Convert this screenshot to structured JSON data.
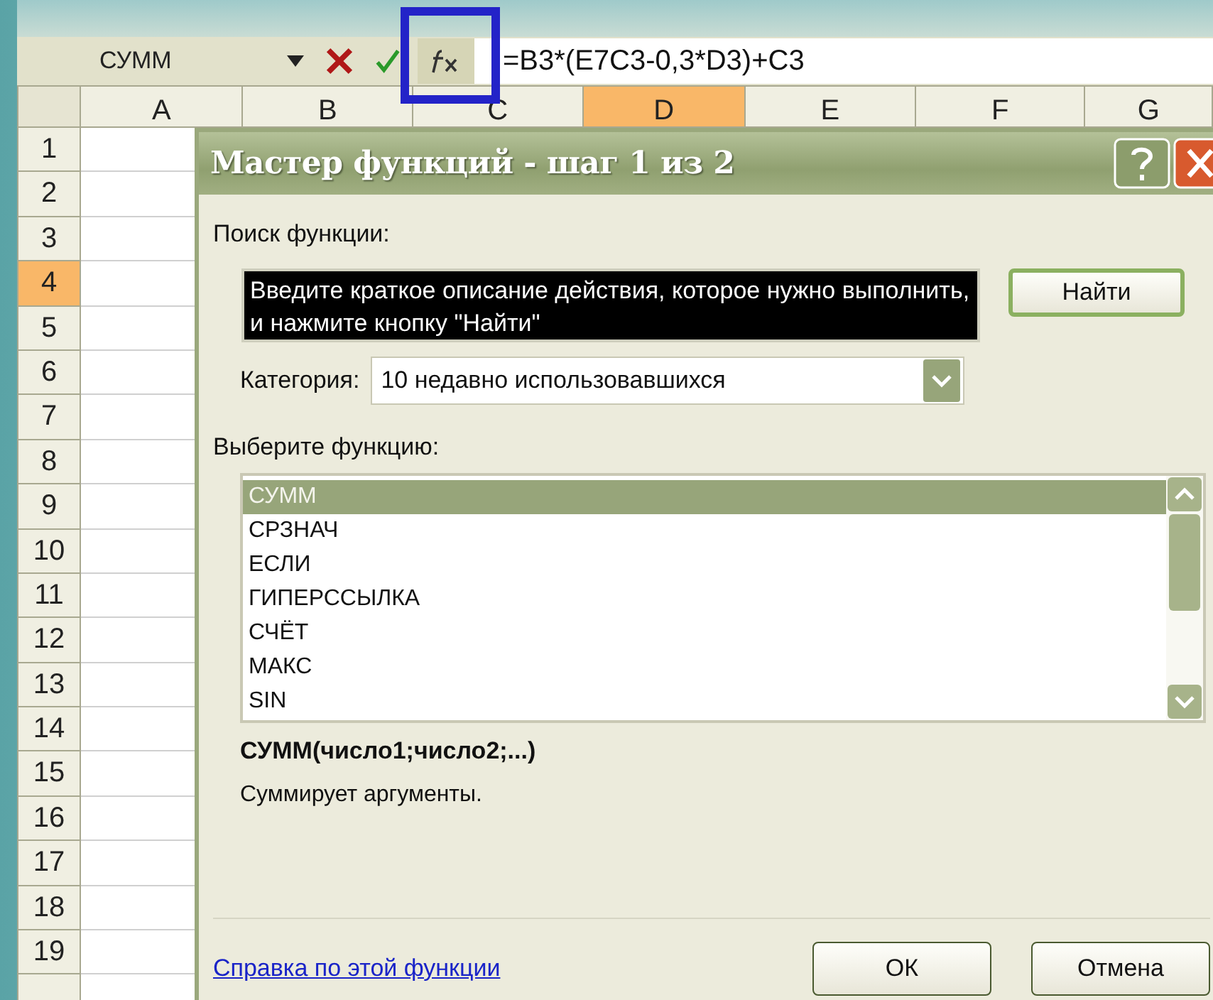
{
  "formula_bar": {
    "name_box": "СУММ",
    "formula": "=B3*(E7C3-0,3*D3)+C3",
    "fx_highlighted": true
  },
  "sheet": {
    "columns": [
      {
        "label": "A",
        "selected": false
      },
      {
        "label": "B",
        "selected": false
      },
      {
        "label": "C",
        "selected": false
      },
      {
        "label": "D",
        "selected": true
      },
      {
        "label": "E",
        "selected": false
      },
      {
        "label": "F",
        "selected": false
      },
      {
        "label": "G",
        "selected": false
      }
    ],
    "rows": [
      {
        "label": "1",
        "selected": false
      },
      {
        "label": "2",
        "selected": false
      },
      {
        "label": "3",
        "selected": false
      },
      {
        "label": "4",
        "selected": true
      },
      {
        "label": "5",
        "selected": false
      },
      {
        "label": "6",
        "selected": false
      },
      {
        "label": "7",
        "selected": false
      },
      {
        "label": "8",
        "selected": false
      },
      {
        "label": "9",
        "selected": false
      },
      {
        "label": "10",
        "selected": false
      },
      {
        "label": "11",
        "selected": false
      },
      {
        "label": "12",
        "selected": false
      },
      {
        "label": "13",
        "selected": false
      },
      {
        "label": "14",
        "selected": false
      },
      {
        "label": "15",
        "selected": false
      },
      {
        "label": "16",
        "selected": false
      },
      {
        "label": "17",
        "selected": false
      },
      {
        "label": "18",
        "selected": false
      },
      {
        "label": "19",
        "selected": false
      }
    ]
  },
  "dialog": {
    "title": "Мастер функций - шаг 1 из 2",
    "search_label": "Поиск функции:",
    "search_value": "Введите краткое описание действия, которое нужно выполнить, и нажмите кнопку \"Найти\"",
    "find_button": "Найти",
    "category_label": "Категория:",
    "category_value": "10 недавно использовавшихся",
    "list_label": "Выберите функцию:",
    "functions": [
      {
        "name": "СУММ",
        "selected": true
      },
      {
        "name": "СРЗНАЧ",
        "selected": false
      },
      {
        "name": "ЕСЛИ",
        "selected": false
      },
      {
        "name": "ГИПЕРССЫЛКА",
        "selected": false
      },
      {
        "name": "СЧЁТ",
        "selected": false
      },
      {
        "name": "МАКС",
        "selected": false
      },
      {
        "name": "SIN",
        "selected": false
      }
    ],
    "signature": "СУММ(число1;число2;...)",
    "description": "Суммирует аргументы.",
    "help_link": "Справка по этой функции",
    "buttons": [
      "ОК",
      "Отмена"
    ]
  }
}
